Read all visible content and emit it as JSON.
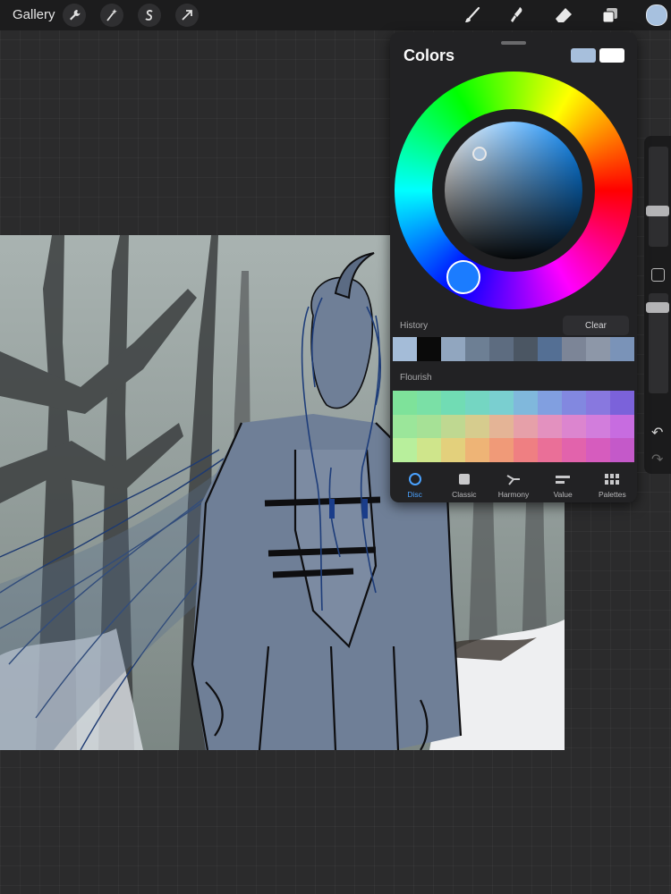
{
  "topbar": {
    "gallery_label": "Gallery",
    "left_tools": [
      "wrench-icon",
      "magic-wand-icon",
      "selection-s-icon",
      "transform-arrow-icon"
    ],
    "right_tools": [
      "brush-icon",
      "smudge-icon",
      "eraser-icon",
      "layers-icon"
    ],
    "current_color": "#a7c1df"
  },
  "colors_panel": {
    "title": "Colors",
    "primary_color": "#a7bfdc",
    "secondary_color": "#ffffff",
    "disc_knob_color": "#a9c3dc",
    "hue_knob_color": "#1b7cff",
    "history_label": "History",
    "clear_label": "Clear",
    "history": [
      "#a4bcd8",
      "#0a0a0a",
      "#91a6bf",
      "#6d7f94",
      "#5d6c80",
      "#4b5663",
      "#546f94",
      "#7c8597",
      "#8d97a8",
      "#7a93b8"
    ],
    "flourish_label": "Flourish",
    "flourish": [
      "#7ee29a",
      "#7ae0a6",
      "#71dcb4",
      "#74d6c2",
      "#7acfd0",
      "#80b8dc",
      "#819fe0",
      "#8288e0",
      "#8878df",
      "#7b62da",
      "#9be69a",
      "#a6e196",
      "#bfd891",
      "#d6cc8e",
      "#e4b496",
      "#e6a0a9",
      "#e391bf",
      "#dc85cf",
      "#d27ddc",
      "#c76ce0",
      "#b8ef9c",
      "#cfe58b",
      "#e3d07c",
      "#eeb476",
      "#f09a78",
      "#ef7f82",
      "#ea6f98",
      "#e263ac",
      "#d65cbe",
      "#c459c9"
    ],
    "tabs": [
      {
        "icon": "circle-icon",
        "label": "Disc",
        "active": true
      },
      {
        "icon": "square-icon",
        "label": "Classic",
        "active": false
      },
      {
        "icon": "harmony-icon",
        "label": "Harmony",
        "active": false
      },
      {
        "icon": "value-sliders-icon",
        "label": "Value",
        "active": false
      },
      {
        "icon": "grid-icon",
        "label": "Palettes",
        "active": false
      }
    ]
  },
  "sidebar": {
    "undo_icon": "undo-icon",
    "redo_icon": "redo-icon"
  }
}
